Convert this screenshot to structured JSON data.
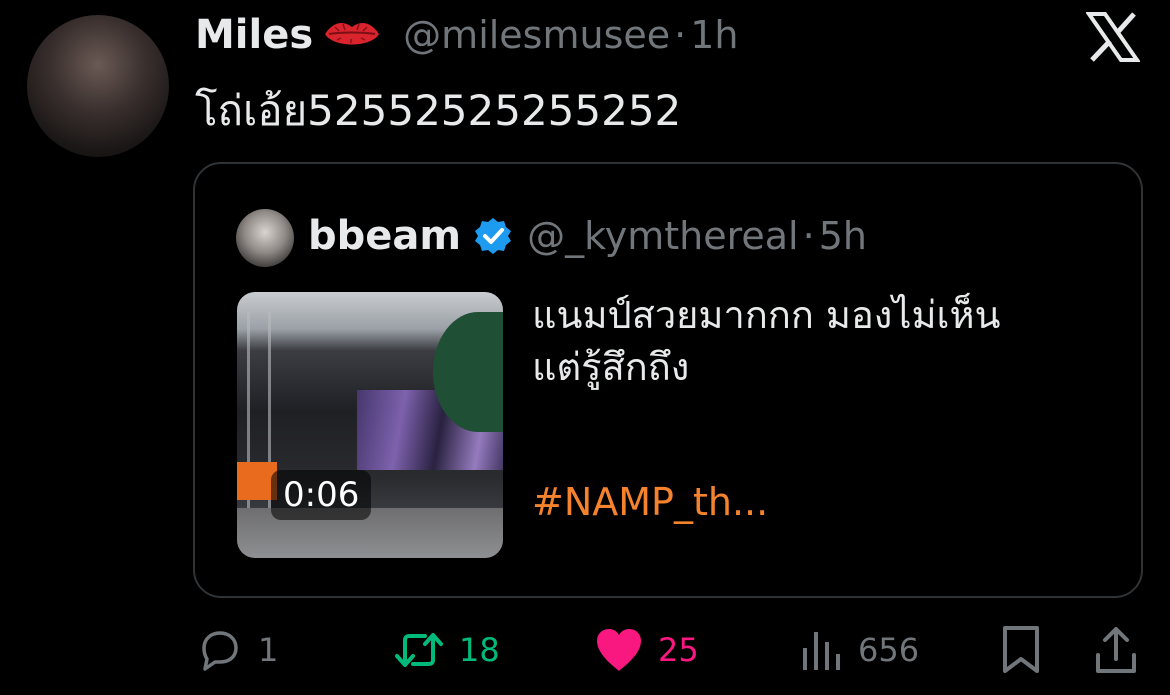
{
  "tweet": {
    "display_name": "Miles",
    "name_emoji": "lips-emoji",
    "handle": "@milesmusee",
    "separator": "·",
    "time": "1h",
    "text": "โถ่เอ้ย52552525255252"
  },
  "quoted_tweet": {
    "display_name": "bbeam",
    "verified": true,
    "handle": "@_kymthereal",
    "separator": "·",
    "time": "5h",
    "text_line1": "แนมป์สวยมากกก มองไม่เห็น",
    "text_line2": "แต่รู้สึกถึง",
    "hashtag": "#NAMP_th...",
    "media": {
      "type": "video",
      "duration": "0:06"
    }
  },
  "actions": {
    "reply_count": "1",
    "retweet_count": "18",
    "like_count": "25",
    "views_count": "656"
  },
  "colors": {
    "background": "#000000",
    "text": "#e7e9ea",
    "muted": "#71767b",
    "retweet": "#00ba7c",
    "like": "#f91880",
    "hashtag": "#f5832d",
    "verified": "#1d9bf0"
  },
  "icons": [
    "x-logo-icon",
    "lips-icon",
    "verified-icon",
    "reply-icon",
    "retweet-icon",
    "heart-icon",
    "views-icon",
    "bookmark-icon",
    "share-icon"
  ]
}
